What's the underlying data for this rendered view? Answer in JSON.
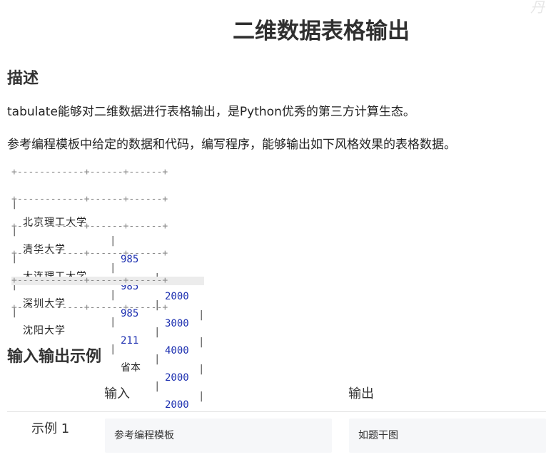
{
  "page": {
    "title": "二维数据表格输出",
    "corner_mark": "丹"
  },
  "description": {
    "heading": "描述",
    "paragraph_1": "tabulate能够对二维数据进行表格输出，是Python优秀的第三方计算生态。",
    "paragraph_2": "参考编程模板中给定的数据和代码，编写程序，能够输出如下风格效果的表格数据。"
  },
  "code_table": {
    "border": "+------------+------+------+",
    "pipe": "|",
    "rows": [
      {
        "name": "北京理工大学",
        "code": "985",
        "score": "2000"
      },
      {
        "name": "清华大学",
        "code": "985",
        "score": "3000"
      },
      {
        "name": "大连理工大学",
        "code": "985",
        "score": "4000"
      },
      {
        "name": "深圳大学",
        "code": "211",
        "score": "2000"
      },
      {
        "name": "沈阳大学",
        "code": "省本",
        "score": "2000"
      }
    ]
  },
  "examples": {
    "heading": "输入输出示例",
    "input_header": "输入",
    "output_header": "输出",
    "rows": [
      {
        "label": "示例 1",
        "input": "参考编程模板",
        "output": "如题干图"
      }
    ]
  },
  "colors": {
    "number_blue": "#1c2fb0",
    "box_bg": "#f6f7f9"
  }
}
